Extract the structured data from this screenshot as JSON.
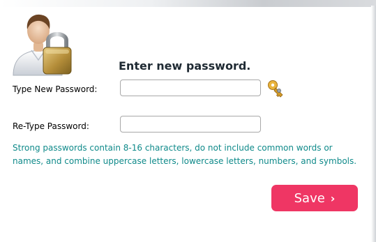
{
  "form": {
    "heading": "Enter new password.",
    "new_password": {
      "label": "Type New Password:",
      "value": "",
      "placeholder": ""
    },
    "retype_password": {
      "label": "Re-Type Password:",
      "value": "",
      "placeholder": ""
    },
    "hint": "Strong passwords contain 8-16 characters, do not include common words or names, and combine uppercase letters, lowercase letters, numbers, and symbols.",
    "save_label": "Save",
    "save_chevron": "›"
  },
  "icons": {
    "avatar": "user-with-padlock-icon",
    "generator": "key-icon"
  },
  "colors": {
    "save_button": "#ef3664",
    "hint_text": "#0f8a8a",
    "heading_text": "#1f2a33"
  }
}
